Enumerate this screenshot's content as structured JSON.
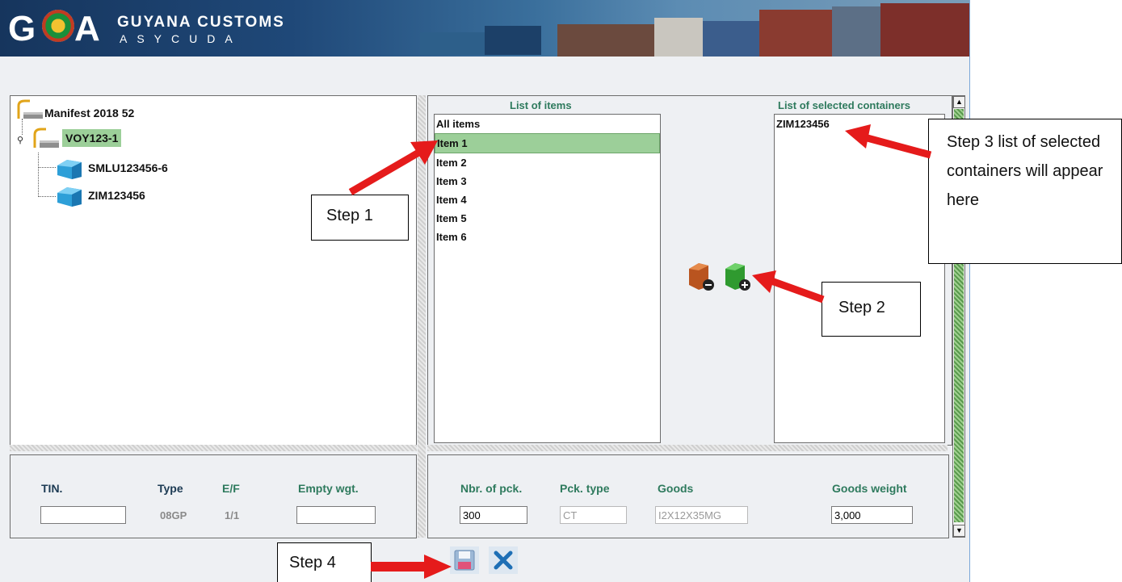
{
  "brand": {
    "title": "GUYANA CUSTOMS",
    "subtitle": "ASYCUDA"
  },
  "tree": {
    "root": "Manifest 2018 52",
    "voyage": "VOY123-1",
    "containers": [
      "SMLU123456-6",
      "ZIM123456"
    ]
  },
  "items_list": {
    "header": "List of items",
    "items": [
      "All items",
      "Item 1",
      "Item 2",
      "Item 3",
      "Item 4",
      "Item 5",
      "Item 6"
    ],
    "selected": "Item 1"
  },
  "selected_containers": {
    "header": "List of selected containers",
    "items": [
      "ZIM123456"
    ]
  },
  "container_form": {
    "tin_label": "TIN.",
    "tin_value": "",
    "type_label": "Type",
    "type_value": "08GP",
    "ef_label": "E/F",
    "ef_value": "1/1",
    "empty_wgt_label": "Empty wgt.",
    "empty_wgt_value": ""
  },
  "item_form": {
    "nbr_pck_label": "Nbr. of pck.",
    "nbr_pck_value": "300",
    "pck_type_label": "Pck. type",
    "pck_type_value": "CT",
    "goods_label": "Goods",
    "goods_value": "I2X12X35MG",
    "goods_weight_label": "Goods weight",
    "goods_weight_value": "3,000"
  },
  "callouts": {
    "step1": "Step 1",
    "step2": "Step 2",
    "step3": "Step 3 list of selected containers will appear here",
    "step4": "Step 4"
  },
  "icons": {
    "remove_container": "container-minus-icon",
    "add_container": "container-plus-icon",
    "save": "floppy-disk-icon",
    "cancel": "close-x-icon"
  },
  "colors": {
    "selection": "#9ccf99",
    "header_green": "#2e7a5d",
    "arrow_red": "#e51b1b"
  }
}
